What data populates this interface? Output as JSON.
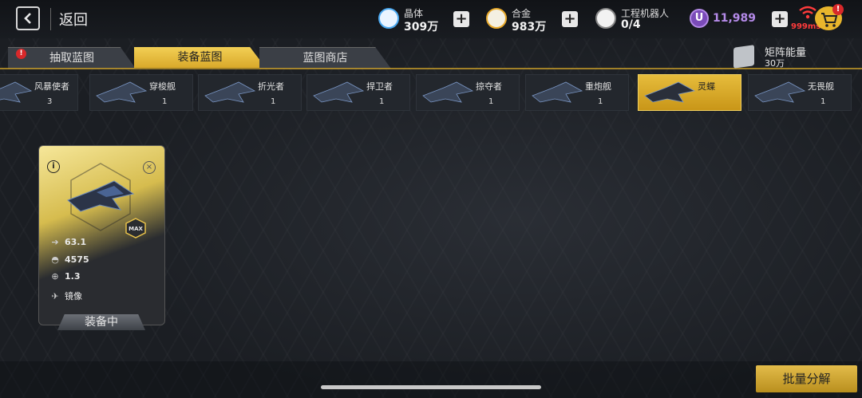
{
  "header": {
    "back_label": "返回",
    "resources": [
      {
        "name": "晶体",
        "value": "309万",
        "icon": "crystal-icon",
        "color": "#4aa8f0"
      },
      {
        "name": "合金",
        "value": "983万",
        "icon": "alloy-icon",
        "color": "#e8a92a"
      },
      {
        "name": "工程机器人",
        "value": "0/4",
        "icon": "robot-icon",
        "color": "#d8d8d8"
      }
    ],
    "u_coin": {
      "label": "U",
      "value": "11,989",
      "color": "#b48ae8"
    },
    "network_ms": "999ms",
    "cart_badge": "!"
  },
  "tabs": [
    {
      "label": "抽取蓝图",
      "active": false,
      "badge": "!"
    },
    {
      "label": "装备蓝图",
      "active": true
    },
    {
      "label": "蓝图商店",
      "active": false
    }
  ],
  "matrix": {
    "label": "矩阵能量",
    "value": "30万"
  },
  "ships": [
    {
      "name": "风暴使者",
      "count": "3"
    },
    {
      "name": "穿梭舰",
      "count": "1"
    },
    {
      "name": "折光者",
      "count": "1"
    },
    {
      "name": "捍卫者",
      "count": "1"
    },
    {
      "name": "掠夺者",
      "count": "1"
    },
    {
      "name": "重炮舰",
      "count": "1"
    },
    {
      "name": "灵蝶",
      "count": "",
      "selected": true
    },
    {
      "name": "无畏舰",
      "count": "1"
    }
  ],
  "card": {
    "info": "i",
    "close": "×",
    "max": "MAX",
    "stats": [
      {
        "icon": "speed-icon",
        "glyph": "➔",
        "value": "63.1"
      },
      {
        "icon": "armor-icon",
        "glyph": "◓",
        "value": "4575"
      },
      {
        "icon": "target-icon",
        "glyph": "⊕",
        "value": "1.3"
      },
      {
        "icon": "mirror-icon",
        "glyph": "✈",
        "value": "镜像"
      }
    ],
    "status": "装备中"
  },
  "bulk_button": "批量分解"
}
